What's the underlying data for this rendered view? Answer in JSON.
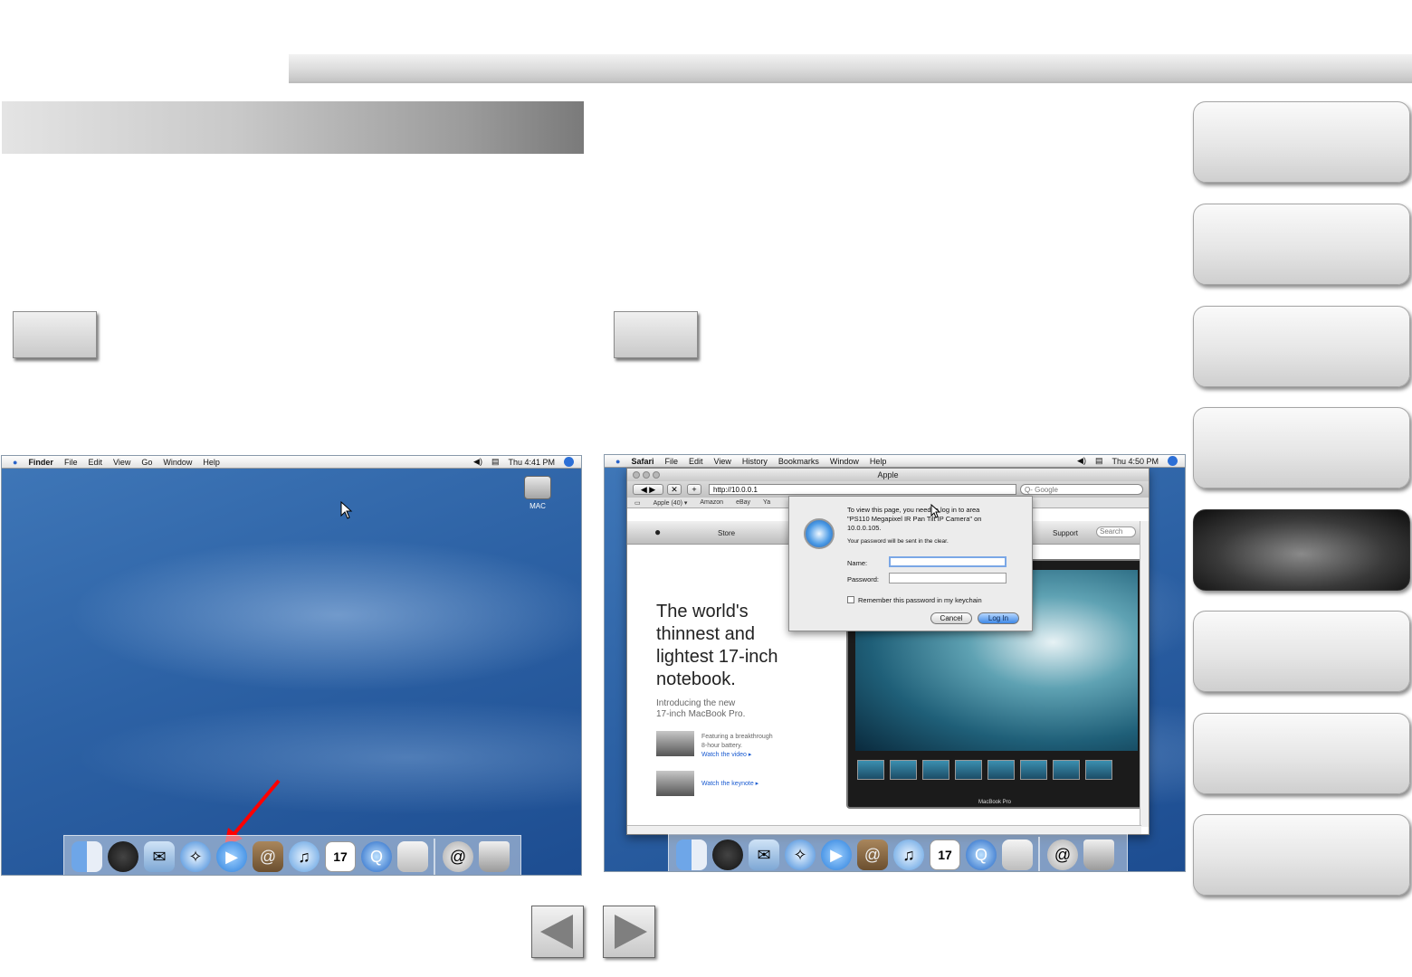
{
  "left_screenshot": {
    "menubar": {
      "app": "Finder",
      "items": [
        "File",
        "Edit",
        "View",
        "Go",
        "Window",
        "Help"
      ],
      "clock": "Thu 4:41 PM"
    },
    "disk_label": "MAC",
    "dock_icons": [
      "finder-icon",
      "dashboard-icon",
      "mail-icon",
      "safari-icon",
      "ichat-icon",
      "address-book-icon",
      "itunes-icon",
      "ical-icon",
      "quicktime-icon",
      "preview-icon",
      "downloads-icon",
      "trash-icon"
    ],
    "highlighted_icon": "ichat-icon"
  },
  "right_screenshot": {
    "menubar": {
      "app": "Safari",
      "items": [
        "File",
        "Edit",
        "View",
        "History",
        "Bookmarks",
        "Window",
        "Help"
      ],
      "clock": "Thu 4:50 PM"
    },
    "window_title": "Apple",
    "url": "http://10.0.0.1",
    "google_placeholder": "Q- Google",
    "bookmarks": [
      "Apple (40) ▾",
      "Amazon",
      "eBay",
      "Ya"
    ],
    "apple_nav": {
      "store": "Store",
      "support": "Support",
      "search": "Search"
    },
    "headline_lines": [
      "The world's",
      "thinnest and",
      "lightest 17-inch",
      "notebook."
    ],
    "subline_lines": [
      "Introducing the new",
      "17-inch MacBook Pro."
    ],
    "feature1": {
      "text_lines": [
        "Featuring a breakthrough",
        "8-hour battery."
      ],
      "link": "Watch the video ▸"
    },
    "feature2": {
      "link": "Watch the keynote ▸"
    },
    "laptop_label": "MacBook Pro",
    "login_sheet": {
      "message_lines": [
        "To view this page, you need to log in to area",
        "\"PS110 Megapixel IR Pan Tilt IP Camera\" on",
        "10.0.0.105."
      ],
      "note": "Your password will be sent in the clear.",
      "name_label": "Name:",
      "password_label": "Password:",
      "remember_label": "Remember this password in my keychain",
      "cancel_label": "Cancel",
      "login_label": "Log In"
    },
    "dock_icons": [
      "finder-icon",
      "dashboard-icon",
      "mail-icon",
      "safari-icon",
      "ichat-icon",
      "address-book-icon",
      "itunes-icon",
      "ical-icon",
      "quicktime-icon",
      "preview-icon",
      "downloads-icon",
      "trash-icon"
    ]
  },
  "side_nav": [
    "nav-1",
    "nav-2",
    "nav-3",
    "nav-4",
    "nav-5",
    "nav-6",
    "nav-7",
    "nav-8"
  ],
  "side_nav_active_index": 4,
  "colors": {
    "arrow": "#ff0000",
    "active_nav": "#1a1a1a",
    "desktop": "#2d62a5"
  }
}
